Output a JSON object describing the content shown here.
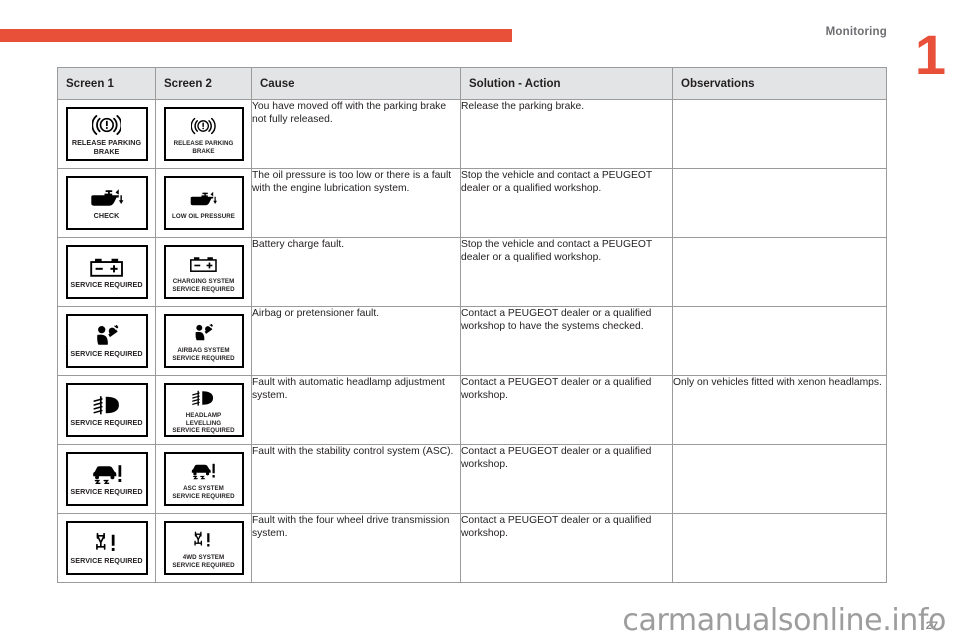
{
  "header": {
    "chapter_title": "Monitoring",
    "chapter_number": "1",
    "accent_color": "#e8503a"
  },
  "footer": {
    "page_number": "27",
    "watermark": "carmanualsonline.info"
  },
  "table": {
    "columns": [
      "Screen 1",
      "Screen 2",
      "Cause",
      "Solution - Action",
      "Observations"
    ],
    "rows": [
      {
        "screen1": {
          "icon": "brake-warning-icon",
          "label": "RELEASE PARKING\nBRAKE"
        },
        "screen2": {
          "icon": "brake-warning-icon",
          "label": "RELEASE PARKING BRAKE"
        },
        "cause": "You have moved off with the parking brake not fully released.",
        "solution": "Release the parking brake.",
        "observations": ""
      },
      {
        "screen1": {
          "icon": "oil-can-icon",
          "label": "CHECK"
        },
        "screen2": {
          "icon": "oil-can-icon",
          "label": "LOW OIL PRESSURE"
        },
        "cause": "The oil pressure is too low or there is a fault with the engine lubrication system.",
        "solution": "Stop the vehicle and contact a PEUGEOT dealer or a qualified workshop.",
        "observations": ""
      },
      {
        "screen1": {
          "icon": "battery-icon",
          "label": "SERVICE REQUIRED"
        },
        "screen2": {
          "icon": "battery-icon",
          "label": "CHARGING SYSTEM\nSERVICE REQUIRED"
        },
        "cause": "Battery charge fault.",
        "solution": "Stop the vehicle and contact a PEUGEOT dealer or a qualified workshop.",
        "observations": ""
      },
      {
        "screen1": {
          "icon": "airbag-icon",
          "label": "SERVICE REQUIRED"
        },
        "screen2": {
          "icon": "airbag-icon",
          "label": "AIRBAG SYSTEM\nSERVICE REQUIRED"
        },
        "cause": "Airbag or pretensioner fault.",
        "solution": "Contact a PEUGEOT dealer or a qualified workshop to have the systems checked.",
        "observations": ""
      },
      {
        "screen1": {
          "icon": "headlamp-levelling-icon",
          "label": "SERVICE REQUIRED"
        },
        "screen2": {
          "icon": "headlamp-levelling-icon",
          "label": "HEADLAMP LEVELLING\nSERVICE REQUIRED"
        },
        "cause": "Fault with automatic headlamp adjustment system.",
        "solution": "Contact a PEUGEOT dealer or a qualified workshop.",
        "observations": "Only on vehicles fitted with xenon headlamps."
      },
      {
        "screen1": {
          "icon": "stability-control-icon",
          "label": "SERVICE REQUIRED"
        },
        "screen2": {
          "icon": "stability-control-icon",
          "label": "ASC SYSTEM\nSERVICE REQUIRED"
        },
        "cause": "Fault with the stability control system (ASC).",
        "solution": "Contact a PEUGEOT dealer or a qualified workshop.",
        "observations": ""
      },
      {
        "screen1": {
          "icon": "four-wheel-drive-icon",
          "label": "SERVICE REQUIRED"
        },
        "screen2": {
          "icon": "four-wheel-drive-icon",
          "label": "4WD SYSTEM\nSERVICE REQUIRED"
        },
        "cause": "Fault with the four wheel drive transmission system.",
        "solution": "Contact a PEUGEOT dealer or a qualified workshop.",
        "observations": ""
      }
    ]
  }
}
